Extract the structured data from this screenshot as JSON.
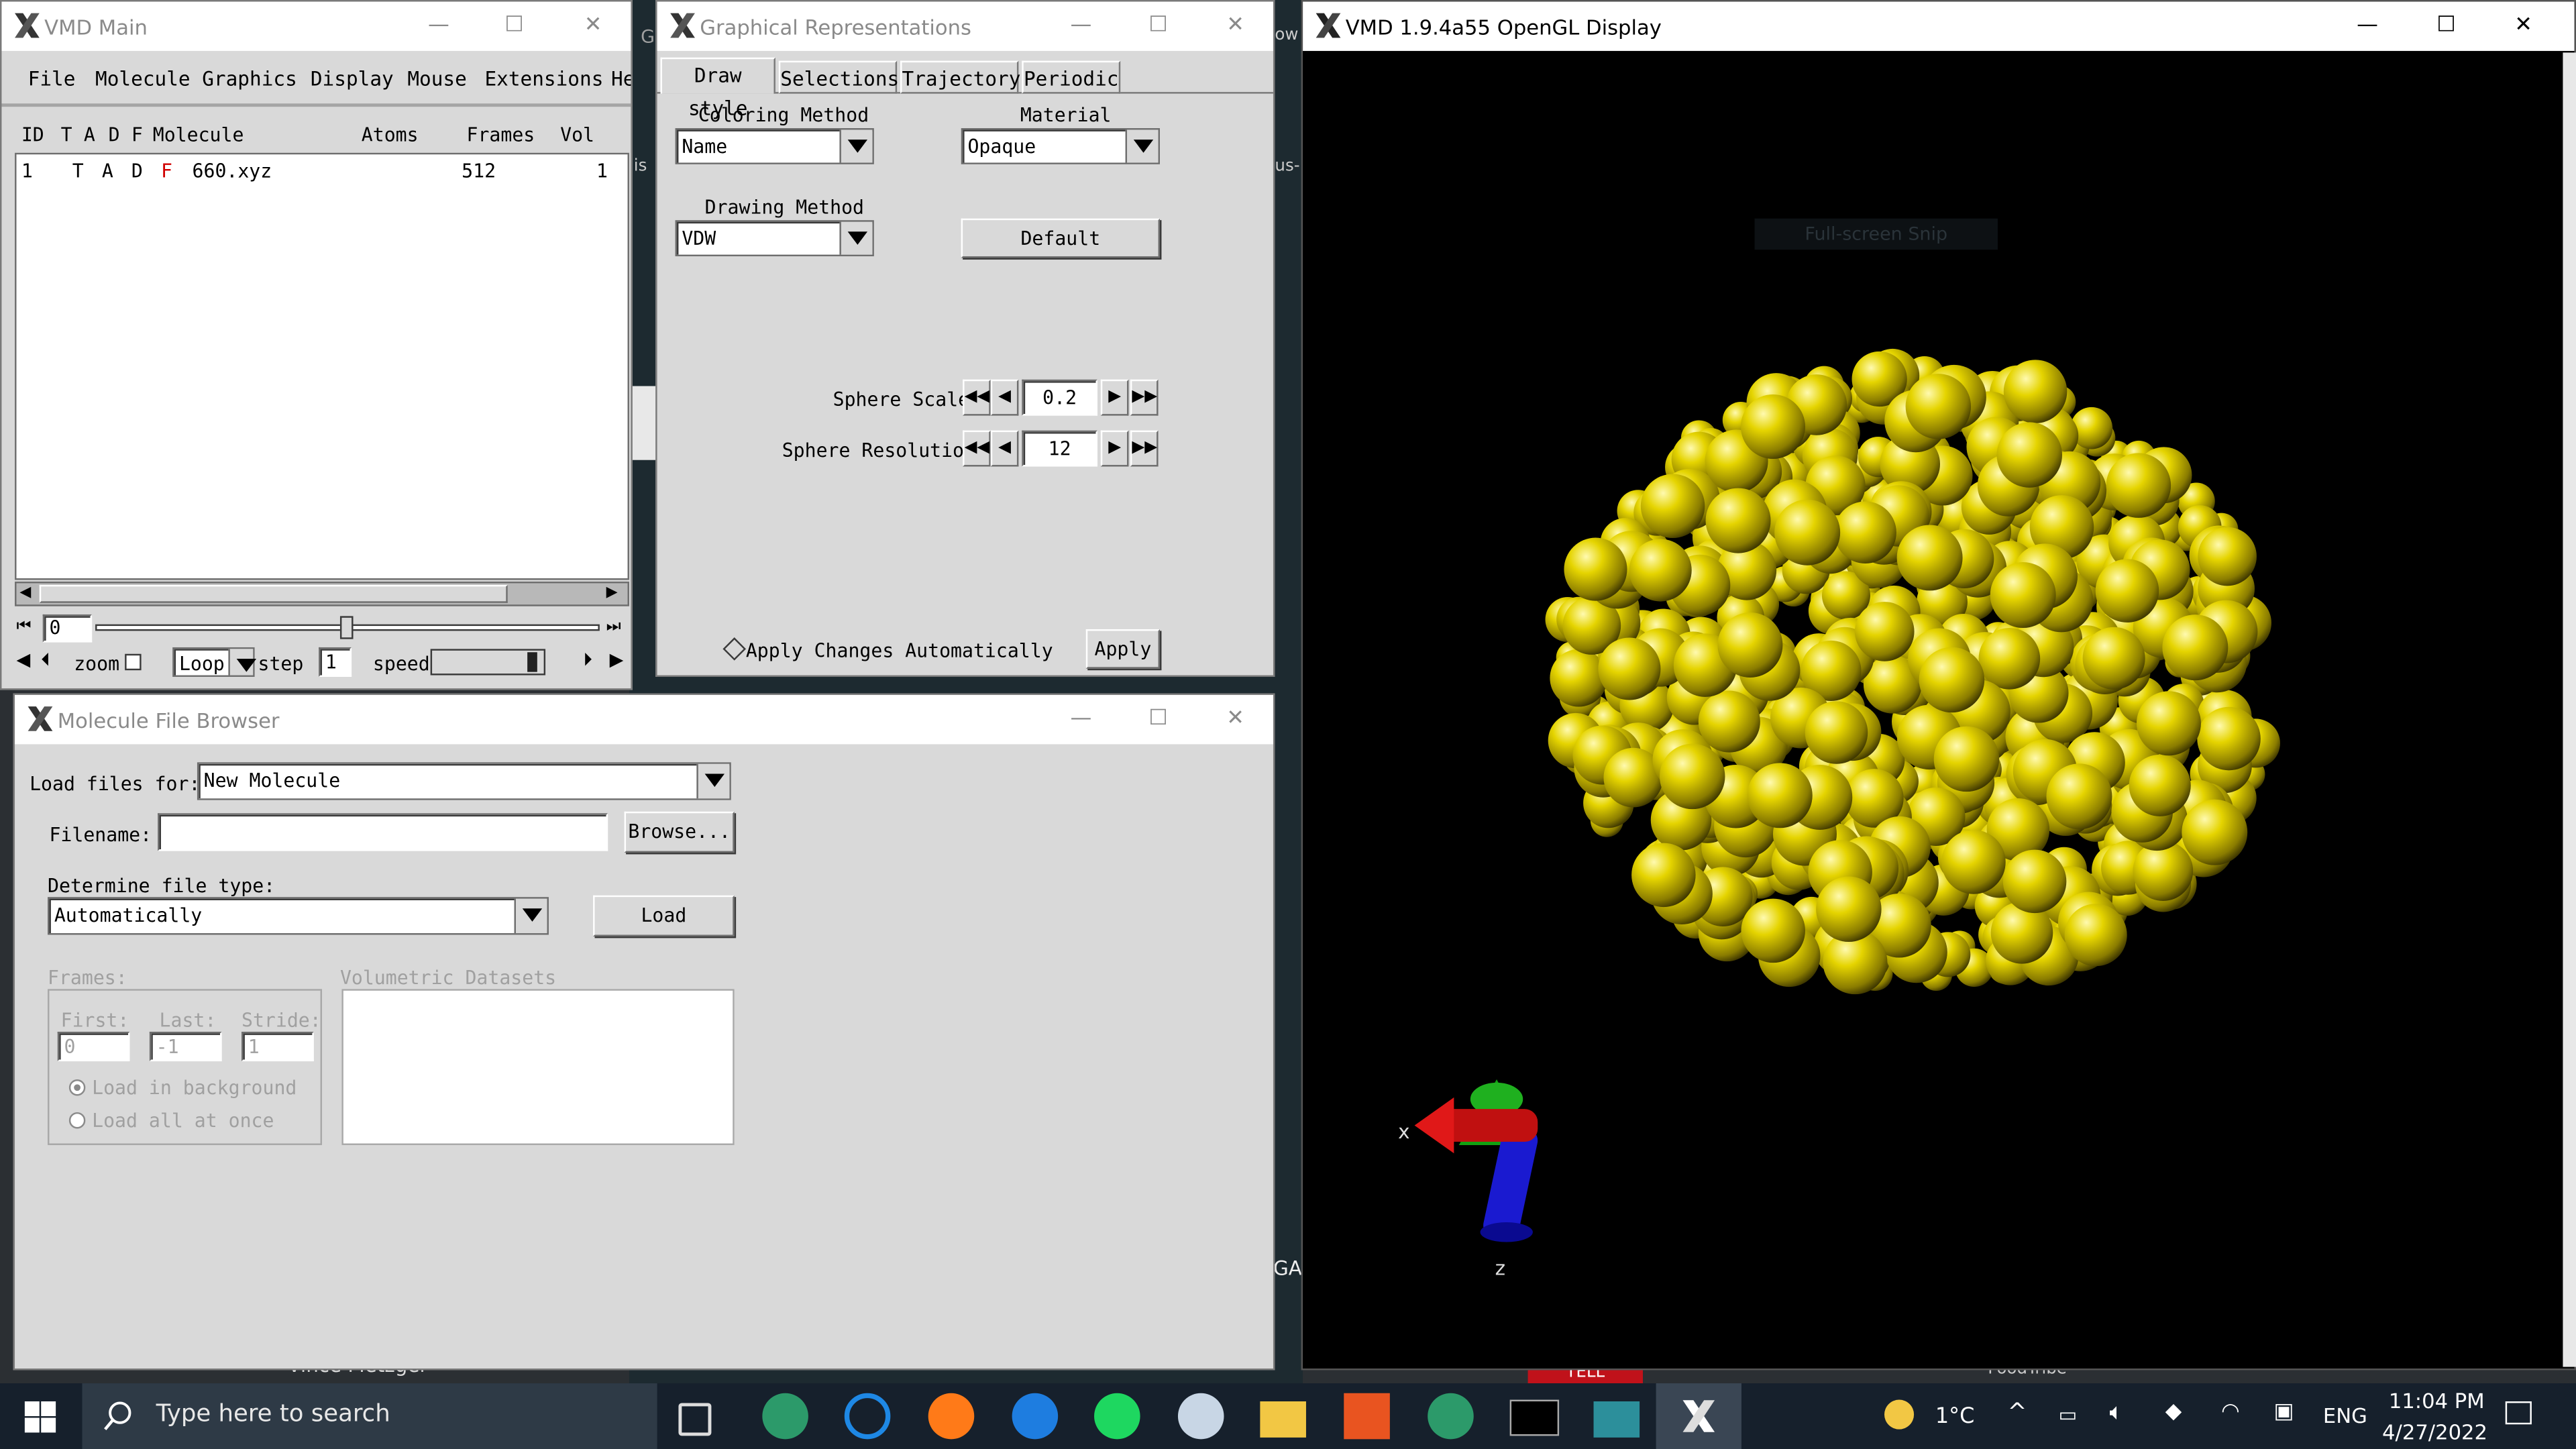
{
  "vmd_main": {
    "title": "VMD Main",
    "menu": [
      "File",
      "Molecule",
      "Graphics",
      "Display",
      "Mouse",
      "Extensions",
      "He"
    ],
    "columns": [
      "ID",
      "T",
      "A",
      "D",
      "F",
      "Molecule",
      "Atoms",
      "Frames",
      "Vol"
    ],
    "rows": [
      {
        "id": "1",
        "t": "T",
        "a": "A",
        "d": "D",
        "f": "F",
        "molecule": "660.xyz",
        "atoms": "",
        "frames": "512",
        "vol": "1"
      }
    ],
    "frame_value": "0",
    "zoom_label": "zoom",
    "loop_value": "Loop",
    "step_label": "step",
    "step_value": "1",
    "speed_label": "speed"
  },
  "graphical_reps": {
    "title": "Graphical Representations",
    "tabs": [
      "Draw style",
      "Selections",
      "Trajectory",
      "Periodic"
    ],
    "coloring_label": "Coloring Method",
    "coloring_value": "Name",
    "material_label": "Material",
    "material_value": "Opaque",
    "drawing_label": "Drawing Method",
    "drawing_value": "VDW",
    "default_button": "Default",
    "sphere_scale_label": "Sphere Scale",
    "sphere_scale_value": "0.2",
    "sphere_res_label": "Sphere Resolution",
    "sphere_res_value": "12",
    "apply_auto_label": "Apply Changes Automatically",
    "apply_button": "Apply"
  },
  "file_browser": {
    "title": "Molecule File Browser",
    "load_for_label": "Load files for:",
    "load_for_value": "New Molecule",
    "filename_label": "Filename:",
    "filename_value": "",
    "browse_button": "Browse...",
    "filetype_label": "Determine file type:",
    "filetype_value": "Automatically",
    "load_button": "Load",
    "frames_label": "Frames:",
    "first_label": "First:",
    "first_value": "0",
    "last_label": "Last:",
    "last_value": "-1",
    "stride_label": "Stride:",
    "stride_value": "1",
    "load_bg_label": "Load in background",
    "load_all_label": "Load all at once",
    "volumetric_label": "Volumetric Datasets"
  },
  "opengl": {
    "title": "VMD 1.9.4a55 OpenGL Display",
    "snip_text": "Full-screen Snip",
    "axis_x": "x",
    "axis_z": "z",
    "atom_color": "#c8b400"
  },
  "background_fragments": {
    "g_label": "G",
    "lis_label": "lis",
    "ow_label": "ow",
    "us_label": "us-",
    "ga_label": "GA",
    "vince_label": "Vince Metzger",
    "tell_label": "TELL",
    "food_label": "FoodTribe"
  },
  "taskbar": {
    "search_placeholder": "Type here to search",
    "temperature": "1°C",
    "language": "ENG",
    "time": "11:04 PM",
    "date": "4/27/2022"
  },
  "window_controls": {
    "minimize": "—",
    "maximize": "☐",
    "close": "✕"
  }
}
